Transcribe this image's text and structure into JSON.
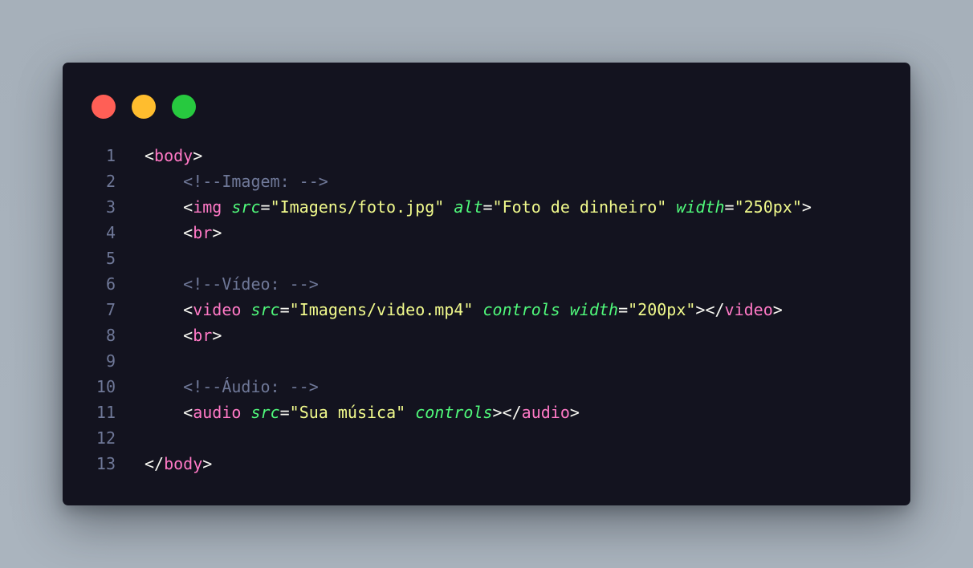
{
  "window": {
    "dots": [
      {
        "name": "close",
        "color": "#ff5f56"
      },
      {
        "name": "minimize",
        "color": "#ffbd2e"
      },
      {
        "name": "maximize",
        "color": "#27c93f"
      }
    ]
  },
  "code": {
    "line_numbers": [
      "1",
      "2",
      "3",
      "4",
      "5",
      "6",
      "7",
      "8",
      "9",
      "10",
      "11",
      "12",
      "13"
    ],
    "lines": [
      [
        {
          "t": "punc",
          "v": "<"
        },
        {
          "t": "tag",
          "v": "body"
        },
        {
          "t": "punc",
          "v": ">"
        }
      ],
      [
        {
          "t": "ws",
          "v": "    "
        },
        {
          "t": "cmt",
          "v": "<!--Imagem: -->"
        }
      ],
      [
        {
          "t": "ws",
          "v": "    "
        },
        {
          "t": "punc",
          "v": "<"
        },
        {
          "t": "tag",
          "v": "img"
        },
        {
          "t": "ws",
          "v": " "
        },
        {
          "t": "attr",
          "v": "src"
        },
        {
          "t": "punc",
          "v": "="
        },
        {
          "t": "str",
          "v": "\"Imagens/foto.jpg\""
        },
        {
          "t": "ws",
          "v": " "
        },
        {
          "t": "attr",
          "v": "alt"
        },
        {
          "t": "punc",
          "v": "="
        },
        {
          "t": "str",
          "v": "\"Foto de dinheiro\""
        },
        {
          "t": "ws",
          "v": " "
        },
        {
          "t": "attr",
          "v": "width"
        },
        {
          "t": "punc",
          "v": "="
        },
        {
          "t": "str",
          "v": "\"250px\""
        },
        {
          "t": "punc",
          "v": ">"
        }
      ],
      [
        {
          "t": "ws",
          "v": "    "
        },
        {
          "t": "punc",
          "v": "<"
        },
        {
          "t": "tag",
          "v": "br"
        },
        {
          "t": "punc",
          "v": ">"
        }
      ],
      [],
      [
        {
          "t": "ws",
          "v": "    "
        },
        {
          "t": "cmt",
          "v": "<!--Vídeo: -->"
        }
      ],
      [
        {
          "t": "ws",
          "v": "    "
        },
        {
          "t": "punc",
          "v": "<"
        },
        {
          "t": "tag",
          "v": "video"
        },
        {
          "t": "ws",
          "v": " "
        },
        {
          "t": "attr",
          "v": "src"
        },
        {
          "t": "punc",
          "v": "="
        },
        {
          "t": "str",
          "v": "\"Imagens/video.mp4\""
        },
        {
          "t": "ws",
          "v": " "
        },
        {
          "t": "attr",
          "v": "controls"
        },
        {
          "t": "ws",
          "v": " "
        },
        {
          "t": "attr",
          "v": "width"
        },
        {
          "t": "punc",
          "v": "="
        },
        {
          "t": "str",
          "v": "\"200px\""
        },
        {
          "t": "punc",
          "v": "></"
        },
        {
          "t": "tag",
          "v": "video"
        },
        {
          "t": "punc",
          "v": ">"
        }
      ],
      [
        {
          "t": "ws",
          "v": "    "
        },
        {
          "t": "punc",
          "v": "<"
        },
        {
          "t": "tag",
          "v": "br"
        },
        {
          "t": "punc",
          "v": ">"
        }
      ],
      [],
      [
        {
          "t": "ws",
          "v": "    "
        },
        {
          "t": "cmt",
          "v": "<!--Áudio: -->"
        }
      ],
      [
        {
          "t": "ws",
          "v": "    "
        },
        {
          "t": "punc",
          "v": "<"
        },
        {
          "t": "tag",
          "v": "audio"
        },
        {
          "t": "ws",
          "v": " "
        },
        {
          "t": "attr",
          "v": "src"
        },
        {
          "t": "punc",
          "v": "="
        },
        {
          "t": "str",
          "v": "\"Sua música\""
        },
        {
          "t": "ws",
          "v": " "
        },
        {
          "t": "attr",
          "v": "controls"
        },
        {
          "t": "punc",
          "v": "></"
        },
        {
          "t": "tag",
          "v": "audio"
        },
        {
          "t": "punc",
          "v": ">"
        }
      ],
      [],
      [
        {
          "t": "punc",
          "v": "</"
        },
        {
          "t": "tag",
          "v": "body"
        },
        {
          "t": "punc",
          "v": ">"
        }
      ]
    ]
  }
}
